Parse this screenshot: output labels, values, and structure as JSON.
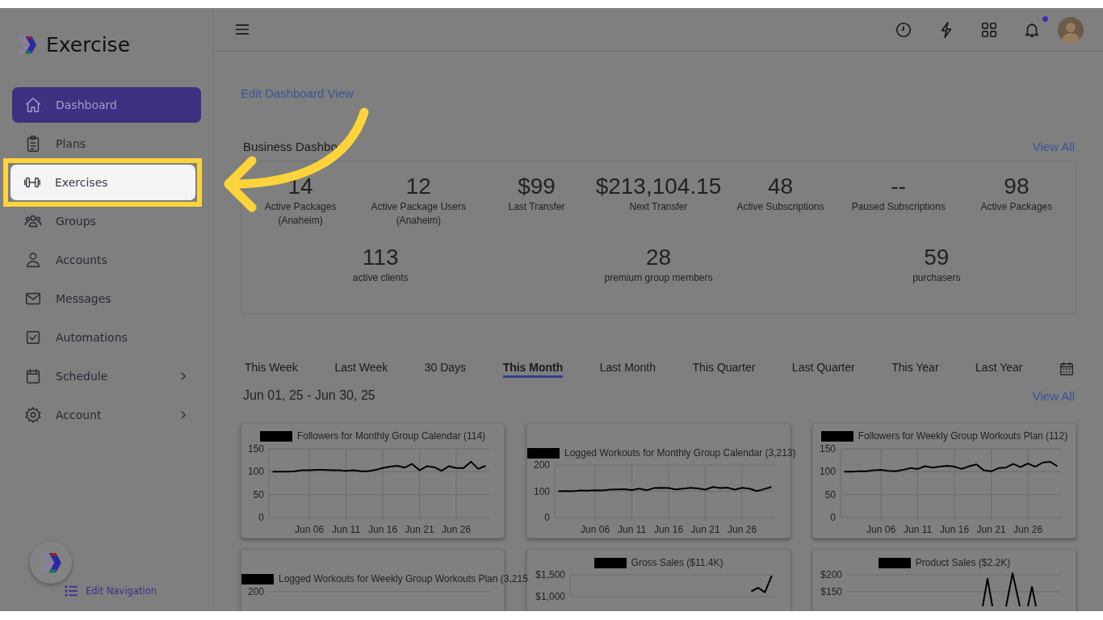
{
  "brand": {
    "name": "Exercise"
  },
  "sidebar": {
    "items": [
      {
        "label": "Dashboard",
        "selected": true,
        "highlighted": false,
        "has_submenu": false
      },
      {
        "label": "Plans",
        "selected": false,
        "highlighted": false,
        "has_submenu": false
      },
      {
        "label": "Exercises",
        "selected": false,
        "highlighted": true,
        "has_submenu": false
      },
      {
        "label": "Groups",
        "selected": false,
        "highlighted": false,
        "has_submenu": false
      },
      {
        "label": "Accounts",
        "selected": false,
        "highlighted": false,
        "has_submenu": false
      },
      {
        "label": "Messages",
        "selected": false,
        "highlighted": false,
        "has_submenu": false
      },
      {
        "label": "Automations",
        "selected": false,
        "highlighted": false,
        "has_submenu": false
      },
      {
        "label": "Schedule",
        "selected": false,
        "highlighted": false,
        "has_submenu": true
      },
      {
        "label": "Account",
        "selected": false,
        "highlighted": false,
        "has_submenu": true
      }
    ],
    "edit_navigation": "Edit Navigation"
  },
  "header": {
    "notifications_unread": true
  },
  "edit_dashboard_link": "Edit Dashboard View",
  "business_dashboard": {
    "title": "Business Dashbo",
    "view_all": "View All",
    "stats": [
      {
        "value": "14",
        "label": "Active Packages (Anaheim)"
      },
      {
        "value": "12",
        "label": "Active Package Users (Anaheim)"
      },
      {
        "value": "$99",
        "label": "Last Transfer"
      },
      {
        "value": "$213,104.15",
        "label": "Next Transfer"
      },
      {
        "value": "48",
        "label": "Active Subscriptions"
      },
      {
        "value": "--",
        "label": "Paused Subscriptions"
      },
      {
        "value": "98",
        "label": "Active Packages"
      }
    ],
    "summary": [
      {
        "value": "113",
        "label": "active clients"
      },
      {
        "value": "28",
        "label": "premium group members"
      },
      {
        "value": "59",
        "label": "purchasers"
      }
    ]
  },
  "period_tabs": [
    {
      "label": "This Week",
      "selected": false
    },
    {
      "label": "Last Week",
      "selected": false
    },
    {
      "label": "30 Days",
      "selected": false
    },
    {
      "label": "This Month",
      "selected": true
    },
    {
      "label": "Last Month",
      "selected": false
    },
    {
      "label": "This Quarter",
      "selected": false
    },
    {
      "label": "Last Quarter",
      "selected": false
    },
    {
      "label": "This Year",
      "selected": false
    },
    {
      "label": "Last Year",
      "selected": false
    }
  ],
  "date_range": "Jun 01, 25 - Jun 30, 25",
  "charts_view_all": "View All",
  "charts": [
    {
      "chart_data": {
        "type": "line",
        "categories": [
          null,
          null,
          null,
          null,
          null,
          "Jun 06",
          null,
          null,
          null,
          null,
          "Jun 11",
          null,
          null,
          null,
          null,
          "Jun 16",
          null,
          null,
          null,
          null,
          "Jun 21",
          null,
          null,
          null,
          null,
          "Jun 26",
          null,
          null,
          null,
          null
        ],
        "ylim": [
          0,
          150
        ],
        "yticks": [
          0,
          50,
          100,
          150
        ],
        "grid": true,
        "series": [
          {
            "name": "Followers for Monthly Group Calendar (114)",
            "color": "#000000",
            "values": [
              100,
              100,
              100,
              101,
              103,
              103,
              104,
              104,
              103,
              103,
              102,
              103,
              101,
              101,
              104,
              108,
              111,
              113,
              109,
              117,
              103,
              112,
              110,
              102,
              112,
              108,
              108,
              122,
              106,
              113
            ]
          }
        ]
      }
    },
    {
      "chart_data": {
        "type": "line",
        "categories": [
          null,
          null,
          null,
          null,
          null,
          "Jun 06",
          null,
          null,
          null,
          null,
          "Jun 11",
          null,
          null,
          null,
          null,
          "Jun 16",
          null,
          null,
          null,
          null,
          "Jun 21",
          null,
          null,
          null,
          null,
          "Jun 26",
          null,
          null,
          null,
          null
        ],
        "ylim": [
          0,
          200
        ],
        "yticks": [
          0,
          100,
          200
        ],
        "grid": true,
        "series": [
          {
            "name": "Logged Workouts for Monthly Group Calendar (3,213)",
            "color": "#000000",
            "values": [
              100,
              101,
              100,
              103,
              102,
              104,
              103,
              106,
              107,
              108,
              105,
              110,
              104,
              112,
              113,
              112,
              107,
              110,
              113,
              111,
              106,
              116,
              112,
              114,
              106,
              113,
              110,
              101,
              108,
              116
            ]
          }
        ]
      }
    },
    {
      "chart_data": {
        "type": "line",
        "categories": [
          null,
          null,
          null,
          null,
          null,
          "Jun 06",
          null,
          null,
          null,
          null,
          "Jun 11",
          null,
          null,
          null,
          null,
          "Jun 16",
          null,
          null,
          null,
          null,
          "Jun 21",
          null,
          null,
          null,
          null,
          "Jun 26",
          null,
          null,
          null,
          null
        ],
        "ylim": [
          0,
          150
        ],
        "yticks": [
          0,
          50,
          100,
          150
        ],
        "grid": true,
        "series": [
          {
            "name": "Followers for Weekly Group Workouts Plan (112)",
            "color": "#000000",
            "values": [
              100,
              100,
              101,
              101,
              103,
              104,
              102,
              101,
              104,
              108,
              106,
              112,
              109,
              111,
              113,
              111,
              106,
              112,
              116,
              103,
              101,
              108,
              109,
              117,
              110,
              118,
              111,
              120,
              122,
              112
            ]
          }
        ]
      }
    },
    {
      "title": "Logged Workouts for Weekly Group Workouts Plan (3,215",
      "y_axis_labels": [
        "200"
      ]
    },
    {
      "chart_data": {
        "type": "line",
        "categories": [
          null,
          null,
          null,
          null,
          null,
          null,
          null,
          null,
          null,
          null,
          null,
          null,
          null,
          null,
          null,
          null,
          null,
          null,
          null,
          null,
          null,
          null,
          null,
          null,
          null,
          null,
          null,
          null,
          null,
          null
        ],
        "ylim": [
          1000,
          1500
        ],
        "yticks": [
          {
            "value": 1000,
            "label": "$1,000"
          },
          {
            "value": 1500,
            "label": "$1,500"
          }
        ],
        "grid": true,
        "series": [
          {
            "name": "Gross Sales ($11.4K)",
            "color": "#000000",
            "values": [
              null,
              null,
              null,
              null,
              null,
              null,
              null,
              null,
              null,
              null,
              null,
              null,
              null,
              null,
              null,
              null,
              null,
              null,
              null,
              null,
              null,
              null,
              null,
              null,
              null,
              null,
              1120,
              1200,
              1100,
              1480
            ]
          }
        ]
      }
    },
    {
      "title": "Product Sales ($2.2K)",
      "y_axis_labels": [
        "$200",
        "$150"
      ],
      "has_line": true
    }
  ]
}
